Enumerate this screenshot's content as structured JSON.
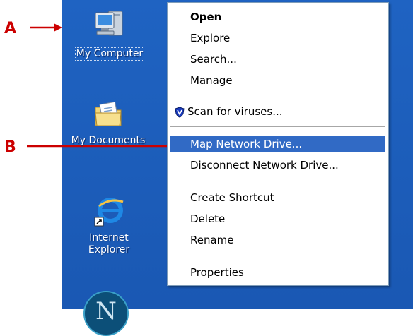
{
  "annotations": {
    "a": "A",
    "b": "B"
  },
  "desktop": {
    "icons": [
      {
        "label": "My Computer"
      },
      {
        "label": "My Documents"
      },
      {
        "label_line1": "Internet",
        "label_line2": "Explorer"
      },
      {
        "glyph": "N"
      }
    ]
  },
  "context_menu": {
    "items": [
      {
        "label": "Open"
      },
      {
        "label": "Explore"
      },
      {
        "label": "Search..."
      },
      {
        "label": "Manage"
      },
      {
        "label": "Scan for viruses..."
      },
      {
        "label": "Map Network Drive..."
      },
      {
        "label": "Disconnect Network Drive..."
      },
      {
        "label": "Create Shortcut"
      },
      {
        "label": "Delete"
      },
      {
        "label": "Rename"
      },
      {
        "label": "Properties"
      }
    ],
    "highlighted_item": "Map Network Drive..."
  },
  "colors": {
    "desktop": "#1c5db9",
    "menu_highlight": "#316ac5",
    "annotation": "#cc0000"
  }
}
